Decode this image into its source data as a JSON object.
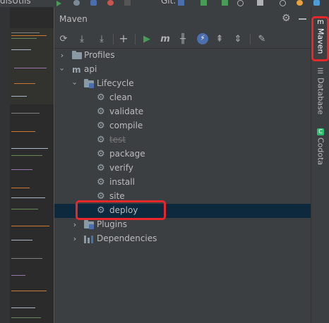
{
  "titlebar": {
    "project_text": "dlsUtils",
    "git_label": "Git:"
  },
  "panel": {
    "title": "Maven"
  },
  "toolbar": {
    "icons": [
      "reload-icon",
      "generate-sources-icon",
      "download-icon",
      "add-icon",
      "run-icon",
      "execute-goal-icon",
      "skip-tests-icon",
      "offline-mode-icon",
      "show-dependencies-icon",
      "collapse-all-icon",
      "settings-wrench-icon"
    ]
  },
  "tree": {
    "profiles": "Profiles",
    "project": "api",
    "lifecycle": "Lifecycle",
    "phases": [
      "clean",
      "validate",
      "compile",
      "test",
      "package",
      "verify",
      "install",
      "site",
      "deploy"
    ],
    "plugins": "Plugins",
    "dependencies": "Dependencies",
    "selected": "deploy",
    "skipped": "test"
  },
  "tool_windows": {
    "maven": "Maven",
    "database": "Database",
    "codota": "Codota"
  },
  "colors": {
    "highlight_box": "#e8272b",
    "selection": "#0d293e",
    "run_green": "#499c54"
  }
}
